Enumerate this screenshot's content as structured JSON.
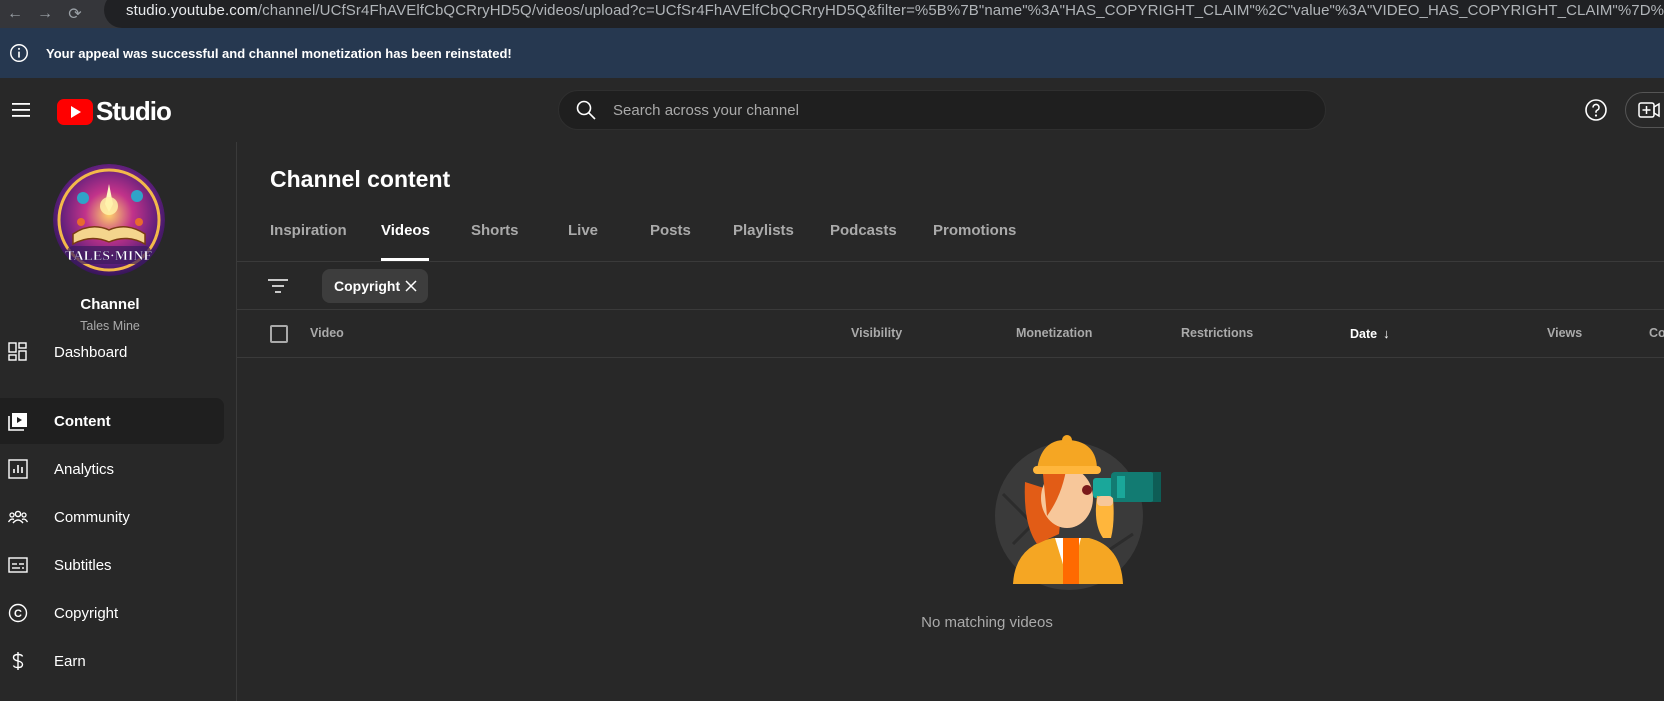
{
  "browser": {
    "url_host": "studio.youtube.com",
    "url_path": "/channel/UCfSr4FhAVElfCbQCRryHD5Q/videos/upload?c=UCfSr4FhAVElfCbQCRryHD5Q&filter=%5B%7B\"name\"%3A\"HAS_COPYRIGHT_CLAIM\"%2C\"value\"%3A\"VIDEO_HAS_COPYRIGHT_CLAIM\"%7D%5D&sort=%7B\"columnType\""
  },
  "banner": {
    "message": "Your appeal was successful and channel monetization has been reinstated!"
  },
  "header": {
    "logo_text": "Studio",
    "search_placeholder": "Search across your channel"
  },
  "sidebar": {
    "avatar_text": "TALES·MINE",
    "channel_label": "Channel",
    "channel_name": "Tales Mine",
    "items": [
      {
        "label": "Dashboard",
        "icon": "dashboard-icon"
      },
      {
        "label": "Content",
        "icon": "content-icon",
        "active": true
      },
      {
        "label": "Analytics",
        "icon": "analytics-icon"
      },
      {
        "label": "Community",
        "icon": "community-icon"
      },
      {
        "label": "Subtitles",
        "icon": "subtitles-icon"
      },
      {
        "label": "Copyright",
        "icon": "copyright-icon"
      },
      {
        "label": "Earn",
        "icon": "earn-icon"
      }
    ]
  },
  "main": {
    "title": "Channel content",
    "tabs": [
      {
        "label": "Inspiration"
      },
      {
        "label": "Videos",
        "active": true
      },
      {
        "label": "Shorts"
      },
      {
        "label": "Live"
      },
      {
        "label": "Posts"
      },
      {
        "label": "Playlists"
      },
      {
        "label": "Podcasts"
      },
      {
        "label": "Promotions"
      }
    ],
    "filter_chip": "Copyright",
    "columns": {
      "video": "Video",
      "visibility": "Visibility",
      "monetization": "Monetization",
      "restrictions": "Restrictions",
      "date": "Date",
      "views": "Views",
      "comments": "Co"
    },
    "empty_message": "No matching videos"
  },
  "colors": {
    "accent_red": "#ff0000",
    "banner_bg": "#263850",
    "page_bg": "#282828"
  }
}
